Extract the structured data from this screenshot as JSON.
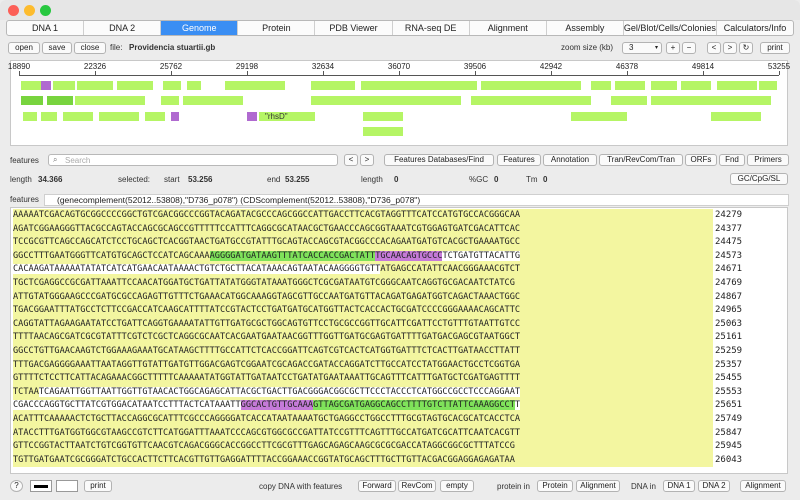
{
  "tabs": [
    "DNA 1",
    "DNA 2",
    "Genome",
    "Protein",
    "PDB Viewer",
    "RNA-seq DE",
    "Alignment",
    "Assembly",
    "Gel/Blot/Cells/Colonies",
    "Calculators/Info"
  ],
  "active_tab": "Genome",
  "toolbar": {
    "open": "open",
    "save": "save",
    "close": "close",
    "file_label": "file:",
    "file_name": "Providencia stuartii.gb",
    "zoom_label": "zoom size (kb)",
    "zoom_value": "3",
    "plus": "+",
    "minus": "−",
    "prev": "<",
    "next": ">",
    "refresh": "↻",
    "print": "print"
  },
  "ruler": [
    "18890",
    "22326",
    "25762",
    "29198",
    "32634",
    "36070",
    "39506",
    "42942",
    "46378",
    "49814",
    "53255"
  ],
  "map_label": "\"rhsD\"",
  "features_bar": {
    "label": "features",
    "search_placeholder": "Search",
    "prev": "<",
    "next": ">",
    "db_find": "Features Databases/Find",
    "features": "Features",
    "annotation": "Annotation",
    "tran": "Tran/RevCom/Tran",
    "orfs": "ORFs",
    "fnd": "Fnd",
    "primers": "Primers"
  },
  "info": {
    "length_label": "length",
    "length": "34.366",
    "selected_label": "selected:",
    "start_label": "start",
    "start": "53.256",
    "end_label": "end",
    "end": "53.255",
    "len2_label": "length",
    "len2": "0",
    "gc_label": "%GC",
    "gc": "0",
    "tm_label": "Tm",
    "tm": "0",
    "gc_btn": "GC/CpG/SL"
  },
  "features_line": {
    "label": "features",
    "text": "(genecomplement(52012..53808),\"D736_p078\")  (CDScomplement(52012..53808),\"D736_p078\")"
  },
  "seq_rows": [
    {
      "seq": "AAAAATCGACAGTGCGGCCCCGGCTGTCGACGGCCCGGTACAGATACGCCCAGCGGCCATTGACCTTCACGTAGGTTTCATCCATGTGCCACGGGCAA",
      "num": "24279"
    },
    {
      "seq": "AGATCGGAAGGGTTACGCCAGTACCAGCGCAGCCGTTTTTCCATTTCAGGCGCATAACGCTGAACCCAGCGGTAAATCGTGGAGTGATCGACATTCAC",
      "num": "24377"
    },
    {
      "seq": "TCCGCGTTCAGCCAGCATCTCCTGCAGCTCACGGTAACTGATGCCGTATTTGCAGTACCAGCGTACGGCCCACAGAATGATGTCACGCTGAAAATGCC",
      "num": "24475"
    },
    {
      "seq": "GGCCTTTGAATGGGTTCATGTGCAGCTCCATCAGCAAAAGGGGATGATAAGTTTATCACCACCGACTATTTGCAACAGTGCCCTCTGATGTTACATTG",
      "num": "24573",
      "segs": [
        [
          0,
          38,
          ""
        ],
        [
          38,
          70,
          "g"
        ],
        [
          70,
          83,
          "p"
        ],
        [
          83,
          100,
          "w"
        ]
      ]
    },
    {
      "seq": "CACAAGATAAAAATATATCATCATGAACAATAAAACTGTCTGCTTACATAAACAGTAATACAAGGGGTGTTATGAGCCATATTCAACGGGAAACGTCT",
      "num": "24671",
      "segs": [
        [
          0,
          71,
          "w"
        ],
        [
          71,
          100,
          ""
        ]
      ]
    },
    {
      "seq": "TGCTCGAGGCCGCGATTAAATTCCAACATGGATGCTGATTATATGGGTATAAATGGGCTCGCGATAATGTCGGGCAATCAGGTGCGACAATCTATCG",
      "num": "24769"
    },
    {
      "seq": "ATTGTATGGGAAGCCCGATGCGCCAGAGTTGTTTCTGAAACATGGCAAAGGTAGCGTTGCCAATGATGTTACAGATGAGATGGTCAGACTAAACTGGC",
      "num": "24867"
    },
    {
      "seq": "TGACGGAATTTATGCCTCTTCCGACCATCAAGCATTTTATCCGTACTCCTGATGATGCATGGTTACTCACCACTGCGATCCCCGGGAAAACAGCATTC",
      "num": "24965"
    },
    {
      "seq": "CAGGTATTAGAAGAATATCCTGATTCAGGTGAAAATATTGTTGATGCGCTGGCAGTGTTCCTGCGCCGGTTGCATTCGATTCCTGTTTGTAATTGTCC",
      "num": "25063"
    },
    {
      "seq": "TTTTAACAGCGATCGCGTATTTCGTCTCGCTCAGGCGCAATCACGAATGAATAACGGTTTGGTTGATGCGAGTGATTTTGATGACGAGCGTAATGGCT",
      "num": "25161"
    },
    {
      "seq": "GGCCTGTTGAACAAGTCTGGAAAGAAATGCATAAGCTTTTGCCATTCTCACCGGATTCAGTCGTCACTCATGGTGATTTCTCACTTGATAACCTTATT",
      "num": "25259"
    },
    {
      "seq": "TTTGACGAGGGGAAATTAATAGGTTGTATTGATGTTGGACGAGTCGGAATCGCAGACCGATACCAGGATCTTGCCATCCTATGGAACTGCCTCGGTGA",
      "num": "25357"
    },
    {
      "seq": "GTTTTCTCCTTCATTACAGAAACGGCTTTTTCAAAAATATGGTATTGATAATCCTGATATGAATAAATTGCAGTTTCATTTGATGCTCGATGAGTTTT",
      "num": "25455"
    },
    {
      "seq": "TCTAATCAGAATTGGTTAATTGGTTGTAACACTGGCAGAGCATTACGCTGACTTGACGGGACGGCGCTTCCCTACCCTCATGGCCGCCTCCCAGGAAT",
      "num": "25553",
      "segs": [
        [
          0,
          5,
          ""
        ],
        [
          5,
          100,
          "w"
        ]
      ]
    },
    {
      "seq": "CGACCCAGGTGCTTATCGTGGACATAATCCTTTACTCATAAATTGGCACTGTTGCAAAGTTAGCGATGAGGCAGCCTTTTGTCTTATTCAAAGGCCTT",
      "num": "25651",
      "segs": [
        [
          0,
          44,
          "w"
        ],
        [
          44,
          58,
          "p"
        ],
        [
          58,
          97,
          "g"
        ],
        [
          97,
          100,
          "w"
        ]
      ]
    },
    {
      "seq": "ACATTTCAAAAACTCTGCTTACCAGGCGCATTTCGCCCAGGGGATCACCATAATAAAATGCTGAGGCCTGGCCTTTGCGTAGTGCACGCATCACCTCA",
      "num": "25749"
    },
    {
      "seq": "ATACCTTTGATGGTGGCGTAAGCCGTCTTCATGGATTTAAATCCCAGCGTGGCGCCGATTATCCGTTTCAGTTTGCCATGATCGCATTCAATCACGTT",
      "num": "25847"
    },
    {
      "seq": "GTTCCGGTACTTAATCTGTCGGTGTTCAACGTCAGACGGGCACCGGCCTTCGCGTTTGAGCAGAGCAAGCGCGCGACCATAGGCGGCGCTTTATCCG",
      "num": "25945"
    },
    {
      "seq": "TGTTGATGAATCGCGGGATCTGCCACTTCTTCACGTTGTTGAGGATTTTACCGGAAACCGGTATGCAGCTTTGCTTGTTACGACGGAGGAGAGATAA",
      "num": "26043"
    }
  ],
  "bottom": {
    "help": "?",
    "print": "print",
    "copy_label": "copy DNA with features",
    "forward": "Forward",
    "revcom": "RevCom",
    "empty": "empty",
    "protein_in": "protein in",
    "protein": "Protein",
    "alignment": "Alignment",
    "dna_in": "DNA in",
    "dna1": "DNA 1",
    "dna2": "DNA 2",
    "alignment2": "Alignment"
  },
  "colors": {
    "accent": "#3a8ef3",
    "feature_light": "#b5f565",
    "feature_dark": "#78d43e",
    "marker": "#b06ad0",
    "seq_yellow": "#f3f6a0",
    "hl_green": "#7fe25a",
    "hl_purple": "#c57ad8"
  }
}
